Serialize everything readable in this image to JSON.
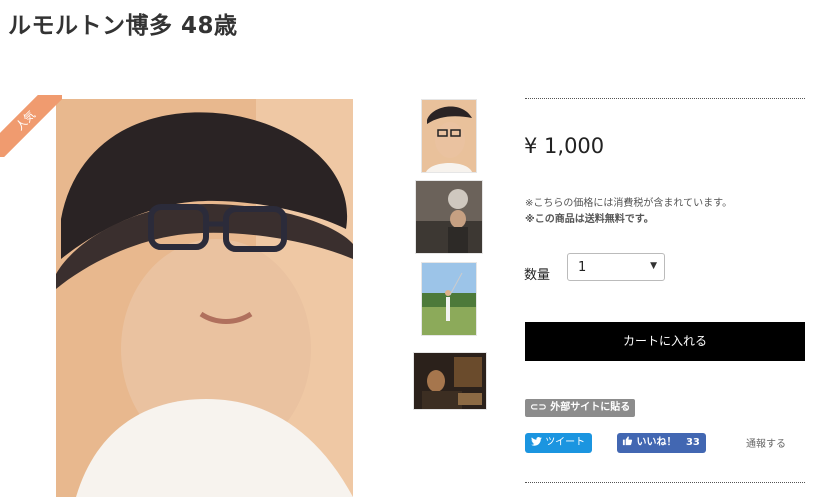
{
  "product": {
    "title": "ルモルトン博多 48歳",
    "badge": "人気",
    "price": "¥ 1,000",
    "tax_note": "※こちらの価格には消費税が含まれています。",
    "shipping_note": "※この商品は送料無料です。",
    "quantity_label": "数量",
    "quantity_value": "1",
    "cart_button": "カートに入れる"
  },
  "share": {
    "embed_label": "外部サイトに貼る",
    "tweet_label": "ツイート",
    "like_label": "いいね！",
    "like_count": "33",
    "report_label": "通報する"
  },
  "colors": {
    "ribbon": "#f09b6f",
    "cart": "#000000",
    "twitter": "#1b95e0",
    "facebook": "#4267b2"
  },
  "icons": [
    "twitter-bird-icon",
    "thumbs-up-icon",
    "link-icon",
    "chevron-down-icon"
  ]
}
